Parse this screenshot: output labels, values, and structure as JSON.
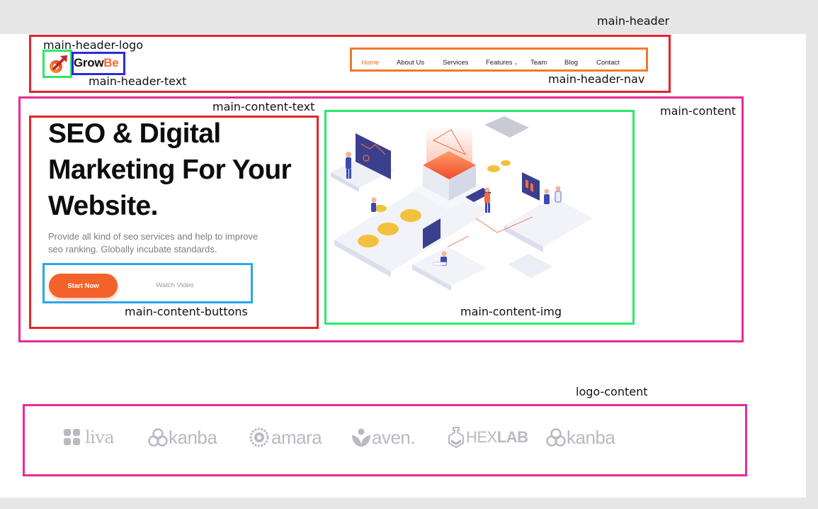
{
  "annotations": {
    "main_header": "main-header",
    "main_header_logo": "main-header-logo",
    "main_header_text": "main-header-text",
    "main_header_nav": "main-header-nav",
    "main_content_text": "main-content-text",
    "main_content": "main-content",
    "main_content_buttons": "main-content-buttons",
    "main_content_img": "main-content-img",
    "logo_content": "logo-content"
  },
  "header": {
    "brand_part1": "Grow",
    "brand_part2": "Be",
    "nav": [
      {
        "label": "Home",
        "active": true
      },
      {
        "label": "About Us"
      },
      {
        "label": "Services"
      },
      {
        "label": "Features"
      },
      {
        "label": "Team"
      },
      {
        "label": "Blog"
      },
      {
        "label": "Contact"
      }
    ]
  },
  "hero": {
    "title_line1": "SEO & Digital",
    "title_line2": "Marketing For Your",
    "title_line3": "Website.",
    "subtitle_line1": "Provide all kind of seo services and help to improve",
    "subtitle_line2": "seo ranking. Globally incubate standards.",
    "start_button": "Start Now",
    "watch_button": "Watch Video"
  },
  "partners": [
    {
      "name": "liva",
      "icon": "puzzle-icon"
    },
    {
      "name": "kanba",
      "icon": "knot-icon"
    },
    {
      "name": "amara",
      "icon": "at-badge-icon"
    },
    {
      "name": "aven.",
      "icon": "leaf-icon"
    },
    {
      "name": "HEX",
      "name2": "LAB",
      "icon": "flask-icon"
    },
    {
      "name": "kanba",
      "icon": "knot-icon"
    }
  ],
  "colors": {
    "accent": "#f2622a",
    "partner_logo": "#b9b9c4"
  }
}
